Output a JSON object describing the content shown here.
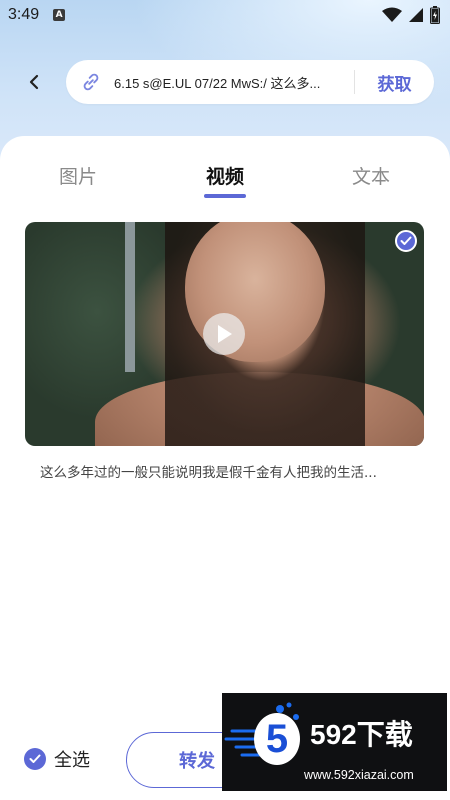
{
  "status_bar": {
    "time": "3:49",
    "notification_icon_letter": "A"
  },
  "header": {
    "url_text": "6.15 s@E.UL 07/22 MwS:/ 这么多...",
    "fetch_label": "获取"
  },
  "tabs": [
    {
      "label": "图片",
      "active": false
    },
    {
      "label": "视频",
      "active": true
    },
    {
      "label": "文本",
      "active": false
    }
  ],
  "video": {
    "caption": "这么多年过的一般只能说明我是假千金有人把我的生活...",
    "selected": true
  },
  "bottom": {
    "select_all_label": "全选",
    "forward_label": "转发"
  },
  "watermark": {
    "logo_digit": "5",
    "title": "592下载",
    "url": "www.592xiazai.com"
  },
  "colors": {
    "accent": "#5c68d6",
    "header_bg": "#c6ddf5",
    "watermark_bg": "#0f1012"
  }
}
